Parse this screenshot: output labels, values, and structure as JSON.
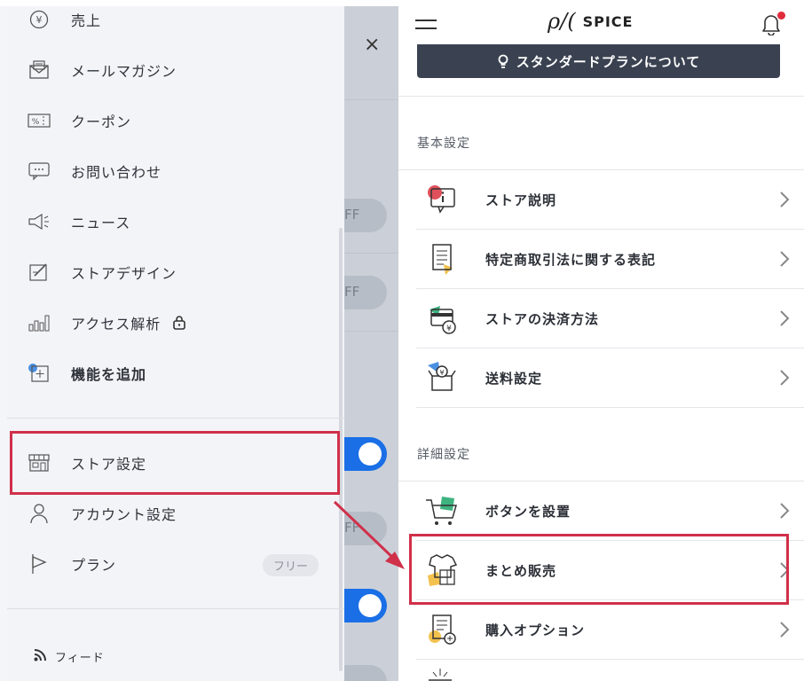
{
  "drawer": {
    "menu": [
      {
        "label": "売上",
        "icon": "yen-circle-icon"
      },
      {
        "label": "メールマガジン",
        "icon": "mail-icon"
      },
      {
        "label": "クーポン",
        "icon": "coupon-icon"
      },
      {
        "label": "お問い合わせ",
        "icon": "chat-bubble-icon"
      },
      {
        "label": "ニュース",
        "icon": "megaphone-icon"
      },
      {
        "label": "ストアデザイン",
        "icon": "design-pencil-icon"
      },
      {
        "label": "アクセス解析",
        "icon": "bar-chart-icon"
      },
      {
        "label": "機能を追加",
        "icon": "add-feature-icon"
      }
    ],
    "settings": [
      {
        "label": "ストア設定",
        "icon": "storefront-icon"
      },
      {
        "label": "アカウント設定",
        "icon": "user-icon"
      },
      {
        "label": "プラン",
        "icon": "flag-icon",
        "badge": "フリー"
      }
    ],
    "feed": {
      "label": "フィード",
      "icon": "rss-icon"
    }
  },
  "background": {
    "close_symbol": "×",
    "toggle_text_1": "FF",
    "toggle_text_2": "FF",
    "toggle_text_3": "FF"
  },
  "header": {
    "logo_script": "ρ/(",
    "logo_text": "SPICE"
  },
  "banner": {
    "label": "スタンダードプランについて"
  },
  "sections": [
    {
      "title": "基本設定",
      "items": [
        {
          "label": "ストア説明",
          "icon": "info-card-icon"
        },
        {
          "label": "特定商取引法に関する表記",
          "icon": "document-icon"
        },
        {
          "label": "ストアの決済方法",
          "icon": "credit-card-yen-icon"
        },
        {
          "label": "送料設定",
          "icon": "box-yen-icon"
        }
      ]
    },
    {
      "title": "詳細設定",
      "items": [
        {
          "label": "ボタンを設置",
          "icon": "cart-icon"
        },
        {
          "label": "まとめ販売",
          "icon": "clothes-set-icon"
        },
        {
          "label": "購入オプション",
          "icon": "document-plus-icon"
        }
      ]
    }
  ],
  "colors": {
    "highlight": "#d0304a",
    "toggle_on": "#1a6fe6",
    "banner_bg": "#3a4150",
    "notification_dot": "#e02c3c"
  }
}
